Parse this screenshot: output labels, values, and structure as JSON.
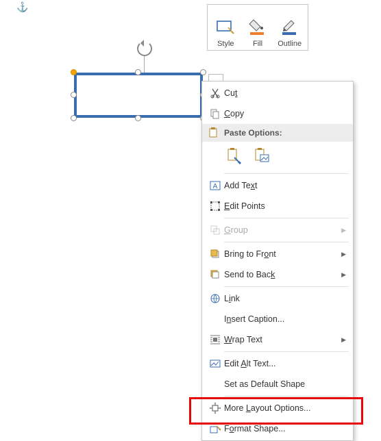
{
  "anchor": {
    "glyph": "⚓"
  },
  "toolbar": {
    "style": "Style",
    "fill": "Fill",
    "outline": "Outline"
  },
  "context_menu": {
    "cut": "Cut",
    "copy": "Copy",
    "paste_options": "Paste Options:",
    "add_text": "Add Text",
    "edit_points": "Edit Points",
    "group": "Group",
    "bring_to_front": "Bring to Front",
    "send_to_back": "Send to Back",
    "link": "Link",
    "insert_caption": "Insert Caption...",
    "wrap_text": "Wrap Text",
    "edit_alt_text": "Edit Alt Text...",
    "set_as_default": "Set as Default Shape",
    "more_layout": "More Layout Options...",
    "format_shape": "Format Shape..."
  },
  "submenu_arrow": "▶",
  "accelerators": {
    "cut": "t",
    "copy": "C",
    "add_text": "x",
    "edit_points": "E",
    "group": "G",
    "bring_to_front": "o",
    "send_to_back": "k",
    "link": "i",
    "insert_caption": "n",
    "wrap_text": "W",
    "edit_alt_text": "A",
    "more_layout": "L",
    "format_shape": "o"
  }
}
